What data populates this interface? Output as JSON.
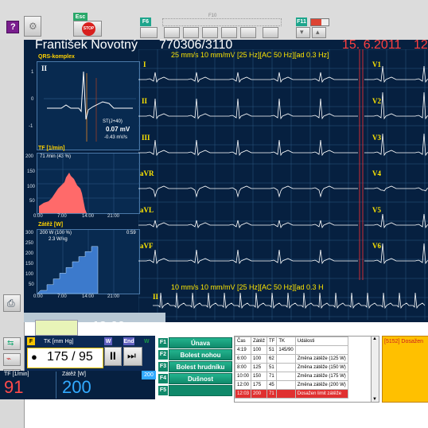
{
  "toolbar": {
    "esc_label": "Esc",
    "stop_label": "STOP",
    "f6_label": "F6",
    "f8_label": "F8",
    "f9_label": "F9",
    "f10_label": "F10",
    "f11_label": "F11",
    "f12_label": "F12",
    "zoom_label": "F10"
  },
  "patient": {
    "name": "František Novotný",
    "id": "770306/3110",
    "date": "15. 6.2011",
    "time": "12"
  },
  "ecg": {
    "settings_top": "25 mm/s  10 mm/mV  [25 Hz][AC 50 Hz][ad 0.3 Hz]",
    "settings_bottom": "10 mm/s  10 mm/mV  [25 Hz][AC 50 Hz][ad 0.3 H",
    "limb_leads": [
      "I",
      "II",
      "III",
      "aVR",
      "aVL",
      "aVF"
    ],
    "chest_leads": [
      "V1",
      "V2",
      "V3",
      "V4",
      "V5",
      "V6"
    ],
    "rhythm_lead": "II"
  },
  "qrs_panel": {
    "title": "QRS-komplex",
    "lead": "II",
    "st_label": "ST(J+40)",
    "st_value": "0.07 mV",
    "st_slope": "-0.43 mV/s",
    "yticks": [
      "1",
      "0",
      "-1"
    ]
  },
  "hr_panel": {
    "title": "TF [1/min]",
    "info": "71 /min  (43 %)",
    "yticks": [
      "200",
      "150",
      "100",
      "50"
    ],
    "xticks": [
      "0:00",
      "7:00",
      "14:00",
      "21:00"
    ]
  },
  "load_panel": {
    "title": "Zátěž [W]",
    "info1": "200 W  (100 %)",
    "info1_time": "0:59",
    "info2": "2.3 W/kg",
    "yticks": [
      "300",
      "250",
      "200",
      "150",
      "100",
      "50"
    ],
    "xticks": [
      "0:00",
      "7:00",
      "14:00",
      "21:00"
    ],
    "steps": [
      0.05,
      0.14,
      0.23,
      0.32,
      0.41,
      0.5,
      0.58,
      0.66,
      0.74
    ]
  },
  "timer": {
    "value": "13:00"
  },
  "bp": {
    "fkey": "F",
    "label": "TK [mm Hg]",
    "value": "175 / 95",
    "w_key": "W",
    "end_key": "End"
  },
  "vitals": {
    "hr_label": "TF [1/min]",
    "hr_value": "91",
    "load_label": "Zátěž [W]",
    "load_value": "200"
  },
  "symptoms": {
    "header": "W",
    "level": "200",
    "buttons": [
      {
        "key": "F1",
        "label": "Únava"
      },
      {
        "key": "F2",
        "label": "Bolest nohou"
      },
      {
        "key": "F3",
        "label": "Bolest hrudníku"
      },
      {
        "key": "F4",
        "label": "Dušnost"
      },
      {
        "key": "F5",
        "label": ""
      }
    ]
  },
  "events": {
    "headers": [
      "Čas",
      "Zátěž",
      "TF",
      "TK",
      "Události"
    ],
    "rows": [
      [
        "4:19",
        "100",
        "51",
        "145/90",
        ""
      ],
      [
        "6:00",
        "100",
        "62",
        "",
        "Změna zátěže (125 W)"
      ],
      [
        "8:00",
        "125",
        "51",
        "",
        "Změna zátěže (150 W)"
      ],
      [
        "10:00",
        "150",
        "71",
        "",
        "Změna zátěže (175 W)"
      ],
      [
        "12:00",
        "175",
        "45",
        "",
        "Změna zátěže (200 W)"
      ],
      [
        "12:03",
        "200",
        "71",
        "",
        "Dosažen limit zátěže"
      ]
    ]
  },
  "alert": {
    "text": "[5152] Dosažen"
  }
}
